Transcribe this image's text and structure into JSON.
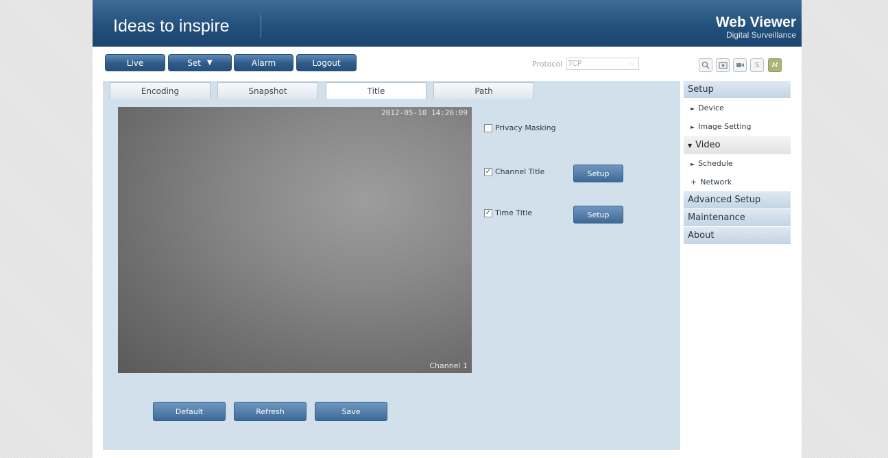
{
  "banner": {
    "title": "Ideas to inspire",
    "brand_main": "Web Viewer",
    "brand_sub": "Digital Surveillance"
  },
  "nav": {
    "live": "Live",
    "set": "Set",
    "alarm": "Alarm",
    "logout": "Logout"
  },
  "protocol": {
    "label": "Protocol",
    "value": "TCP"
  },
  "tools": {
    "search_icon": "search-icon",
    "snapshot_icon": "snapshot-icon",
    "record_icon": "record-icon",
    "s_label": "S",
    "m_label": "M"
  },
  "tabs": [
    {
      "label": "Encoding"
    },
    {
      "label": "Snapshot"
    },
    {
      "label": "Title"
    },
    {
      "label": "Path"
    }
  ],
  "video": {
    "timestamp": "2012-05-10 14:26:09",
    "channel": "Channel 1"
  },
  "options": {
    "privacy_masking": {
      "label": "Privacy Masking",
      "checked": false
    },
    "channel_title": {
      "label": "Channel Title",
      "checked": true
    },
    "time_title": {
      "label": "Time Title",
      "checked": true
    },
    "setup_label": "Setup"
  },
  "actions": {
    "default": "Default",
    "refresh": "Refresh",
    "save": "Save"
  },
  "sidebar": {
    "setup": "Setup",
    "items": [
      {
        "label": "Device",
        "bullet": "►"
      },
      {
        "label": "Image Setting",
        "bullet": "►"
      },
      {
        "label": "Video",
        "bullet": "▼"
      },
      {
        "label": "Schedule",
        "bullet": "►"
      },
      {
        "label": "Network",
        "bullet": "+"
      }
    ],
    "advanced": "Advanced Setup",
    "maintenance": "Maintenance",
    "about": "About"
  }
}
